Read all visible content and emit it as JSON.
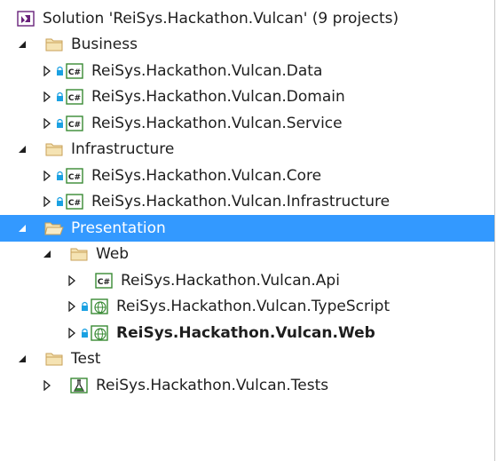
{
  "solution": {
    "label": "Solution 'ReiSys.Hackathon.Vulcan' (9 projects)"
  },
  "folders": {
    "business": "Business",
    "infrastructure": "Infrastructure",
    "presentation": "Presentation",
    "web": "Web",
    "test": "Test"
  },
  "projects": {
    "data": "ReiSys.Hackathon.Vulcan.Data",
    "domain": "ReiSys.Hackathon.Vulcan.Domain",
    "service": "ReiSys.Hackathon.Vulcan.Service",
    "core": "ReiSys.Hackathon.Vulcan.Core",
    "infrastructure": "ReiSys.Hackathon.Vulcan.Infrastructure",
    "api": "ReiSys.Hackathon.Vulcan.Api",
    "typescript": "ReiSys.Hackathon.Vulcan.TypeScript",
    "web": "ReiSys.Hackathon.Vulcan.Web",
    "tests": "ReiSys.Hackathon.Vulcan.Tests"
  },
  "icons": {
    "solution": "visual-studio-solution-icon",
    "folder": "solution-folder-icon",
    "csharp": "csharp-project-icon",
    "web": "web-project-icon",
    "test": "test-project-icon",
    "lock": "source-control-lock-icon"
  },
  "colors": {
    "selection": "#3399ff",
    "folder": "#dcb67a",
    "csharp": "#388a34",
    "lock": "#1ba1e2",
    "vs_purple": "#68217a"
  }
}
